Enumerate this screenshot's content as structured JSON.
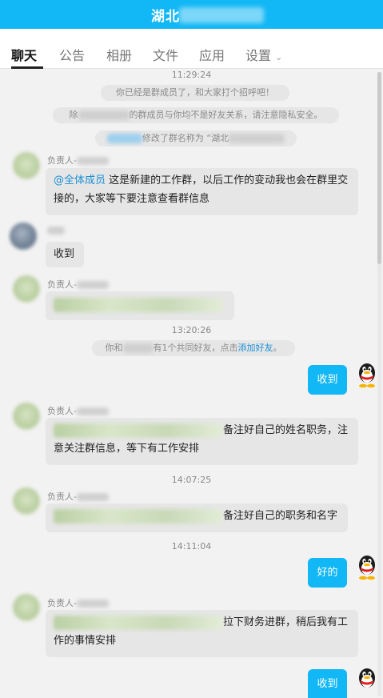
{
  "header": {
    "title": "湖北"
  },
  "tabs": [
    {
      "label": "聊天",
      "active": true
    },
    {
      "label": "公告"
    },
    {
      "label": "相册"
    },
    {
      "label": "文件"
    },
    {
      "label": "应用"
    },
    {
      "label": "设置"
    }
  ],
  "messages": {
    "time1": "11:29:24",
    "sys1": "你已经是群成员了，和大家打个招呼吧！",
    "sys2_prefix": "除",
    "sys2_text": "的群成员与你均不是好友关系，请注意隐私安全。",
    "sys3_text": "修改了群名称为 “湖北",
    "m1_sender": "负责人-",
    "m1_mention": "@全体成员",
    "m1_text": " 这是新建的工作群，以后工作的变动我也会在群里交接的，大家等下要注意查看群信息",
    "m2_text": "收到",
    "m3_sender": "负责人-",
    "time2": "13:20:26",
    "sys4_prefix": "你和",
    "sys4_text": "有1个共同好友，点击",
    "sys4_link": "添加好友",
    "sys4_suffix": "。",
    "my1": "收到",
    "m4_sender": "负责人-",
    "m4_text1": "备注好自己的姓名职务，注",
    "m4_text2": "意关注群信息，等下有工作安排",
    "time3": "14:07:25",
    "m5_sender": "负责人-",
    "m5_text": "备注好自己的职务和名字",
    "time4": "14:11:04",
    "my2": "好的",
    "m6_sender": "负责人-",
    "m6_text1": "拉下财务进群，稍后我有工",
    "m6_text2": "作的事情安排",
    "my3": "收到"
  },
  "colors": {
    "accent": "#12b7f5",
    "link": "#1a8fd6"
  },
  "icons": [
    "chevron-down-icon",
    "qq-penguin-icon"
  ]
}
